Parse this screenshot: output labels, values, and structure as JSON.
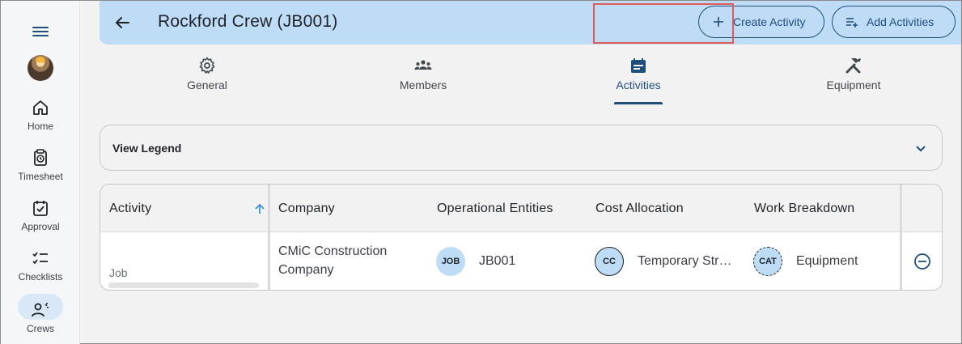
{
  "rail": {
    "items": [
      {
        "label": "Home",
        "icon": "home-icon"
      },
      {
        "label": "Timesheet",
        "icon": "timesheet-icon"
      },
      {
        "label": "Approval",
        "icon": "approval-icon"
      },
      {
        "label": "Checklists",
        "icon": "checklist-icon"
      },
      {
        "label": "Crews",
        "icon": "crews-icon"
      }
    ],
    "active": "Crews"
  },
  "header": {
    "title": "Rockford Crew (JB001)",
    "create_label": "Create Activity",
    "add_label": "Add Activities"
  },
  "tabs": [
    {
      "label": "General",
      "icon": "gear-icon"
    },
    {
      "label": "Members",
      "icon": "members-icon"
    },
    {
      "label": "Activities",
      "icon": "calendar-icon"
    },
    {
      "label": "Equipment",
      "icon": "tools-icon"
    }
  ],
  "active_tab": "Activities",
  "legend": {
    "label": "View Legend"
  },
  "table": {
    "columns": [
      "Activity",
      "Company",
      "Operational Entities",
      "Cost Allocation",
      "Work Breakdown"
    ],
    "rows": [
      {
        "activity": "Job",
        "company_line1": "CMiC Construction",
        "company_line2": "Company",
        "op_chip": "JOB",
        "op_value": "JB001",
        "cost_chip": "CC",
        "cost_value": "Temporary Str…",
        "wb_chip": "CAT",
        "wb_value": "Equipment"
      }
    ]
  },
  "colors": {
    "accent": "#1f4e79",
    "header_bg": "#bfdcf7",
    "highlight": "#e05a5a"
  }
}
